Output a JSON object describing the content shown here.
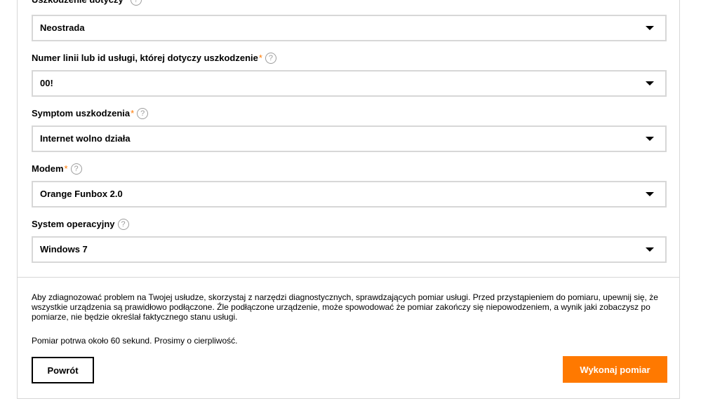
{
  "form": {
    "required_mark": "*",
    "help_glyph": "?",
    "fields": [
      {
        "label": "Uszkodzenie dotyczy",
        "required": true,
        "value": "Neostrada"
      },
      {
        "label": "Numer linii lub id usługi, której dotyczy uszkodzenie",
        "required": true,
        "value": "00!"
      },
      {
        "label": "Symptom uszkodzenia",
        "required": true,
        "value": "Internet wolno działa"
      },
      {
        "label": "Modem",
        "required": true,
        "value": "Orange Funbox 2.0"
      },
      {
        "label": "System operacyjny",
        "required": false,
        "value": "Windows 7"
      }
    ]
  },
  "info": {
    "paragraph": "Aby zdiagnozować problem na Twojej usłudze, skorzystaj z narzędzi diagnostycznych, sprawdzających pomiar usługi. Przed przystąpieniem do pomiaru, upewnij się, że wszystkie urządzenia są prawidłowo podłączone. Źle podłączone urządzenie, może spowodować że pomiar zakończy się niepowodzeniem, a wynik jaki zobaczysz po pomiarze, nie będzie określał faktycznego stanu usługi.",
    "note": "Pomiar potrwa około 60 sekund. Prosimy o cierpliwość."
  },
  "buttons": {
    "back": "Powrót",
    "run": "Wykonaj pomiar"
  },
  "colors": {
    "accent": "#ff7900",
    "border": "#d7d7d7",
    "help": "#9d9d9d"
  }
}
